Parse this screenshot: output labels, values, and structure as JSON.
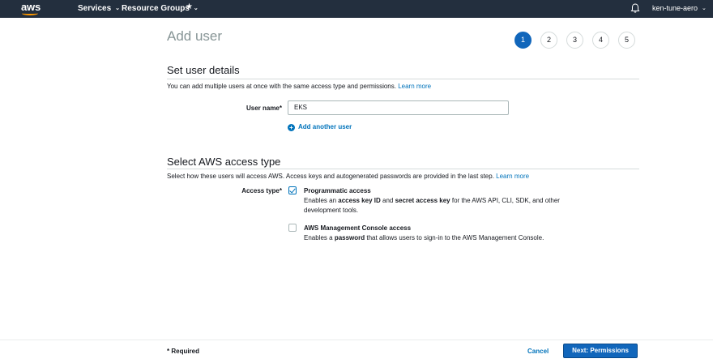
{
  "nav": {
    "logo": "aws",
    "services": "Services",
    "resource_groups": "Resource Groups",
    "account": "ken-tune-aero"
  },
  "header": {
    "title": "Add user",
    "steps": [
      "1",
      "2",
      "3",
      "4",
      "5"
    ],
    "active_step": 1
  },
  "details": {
    "title": "Set user details",
    "description": "You can add multiple users at once with the same access type and permissions.",
    "learn_more": "Learn more",
    "user_name_label": "User name*",
    "user_name_value": "EKS",
    "add_another": "Add another user"
  },
  "access": {
    "title": "Select AWS access type",
    "description": "Select how these users will access AWS. Access keys and autogenerated passwords are provided in the last step.",
    "learn_more": "Learn more",
    "label": "Access type*",
    "programmatic": {
      "title": "Programmatic access",
      "desc_1": "Enables an ",
      "bold_1": "access key ID",
      "desc_2": " and ",
      "bold_2": "secret access key",
      "desc_3": " for the AWS API, CLI, SDK, and other development tools.",
      "checked": true
    },
    "console": {
      "title": "AWS Management Console access",
      "desc_1": "Enables a ",
      "bold_1": "password",
      "desc_2": " that allows users to sign-in to the AWS Management Console.",
      "checked": false
    }
  },
  "footer": {
    "required": "* Required",
    "cancel": "Cancel",
    "next": "Next: Permissions"
  },
  "colors": {
    "nav_bg": "#232f3e",
    "accent": "#1166bb",
    "link": "#0073bb",
    "logo_smile": "#ff9900"
  }
}
